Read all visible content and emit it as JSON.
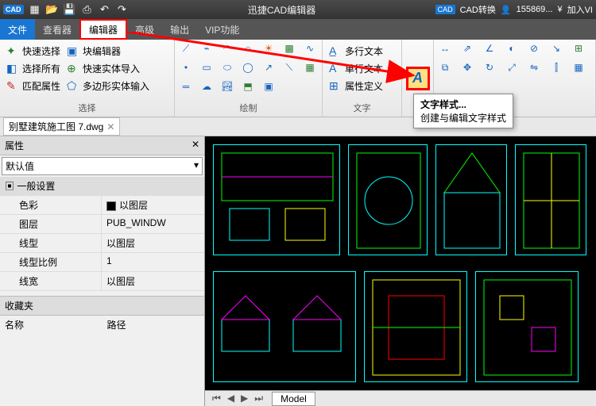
{
  "title": "迅捷CAD编辑器",
  "titlebar_right": {
    "convert": "CAD转换",
    "phone": "155869...",
    "join": "加入VI"
  },
  "menu": {
    "file": "文件",
    "view": "查看器",
    "editor": "编辑器",
    "advanced": "高级",
    "output": "输出",
    "vip": "VIP功能"
  },
  "ribbon": {
    "select": {
      "quick": "快速选择",
      "fast_editor": "块编辑器",
      "all": "选择所有",
      "import": "快速实体导入",
      "match": "匹配属性",
      "poly": "多边形实体输入",
      "group": "选择"
    },
    "draw": {
      "group": "绘制"
    },
    "text": {
      "mtext": "多行文本",
      "stext": "单行文本",
      "attr": "属性定义",
      "group": "文字"
    },
    "tooltip": {
      "title": "文字样式...",
      "desc": "创建与编辑文字样式"
    }
  },
  "doctab": {
    "name": "别墅建筑施工图 7.dwg"
  },
  "props": {
    "title": "属性",
    "default": "默认值",
    "general": "一般设置",
    "rows": [
      {
        "k": "色彩",
        "v": "以图层",
        "swatch": true
      },
      {
        "k": "图层",
        "v": "PUB_WINDW"
      },
      {
        "k": "线型",
        "v": "以图层"
      },
      {
        "k": "线型比例",
        "v": "1"
      },
      {
        "k": "线宽",
        "v": "以图层"
      }
    ]
  },
  "fav": {
    "title": "收藏夹",
    "name": "名称",
    "path": "路径"
  },
  "bottom": {
    "model": "Model"
  }
}
